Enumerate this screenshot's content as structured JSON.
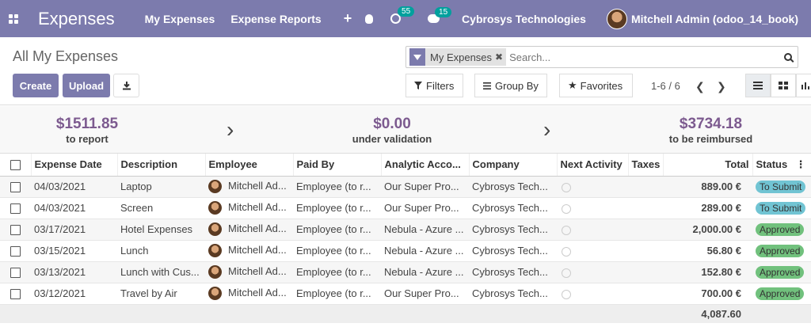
{
  "navbar": {
    "brand": "Expenses",
    "menus": [
      "My Expenses",
      "Expense Reports"
    ],
    "plus": "+",
    "activity_count": "55",
    "message_count": "15",
    "company": "Cybrosys Technologies",
    "user": "Mitchell Admin (odoo_14_book)",
    "color": "#7c7bad"
  },
  "control": {
    "breadcrumb": "All My Expenses",
    "create_label": "Create",
    "upload_label": "Upload",
    "search_facet": "My Expenses",
    "search_placeholder": "Search...",
    "filters_label": "Filters",
    "groupby_label": "Group By",
    "favorites_label": "Favorites",
    "pager": "1-6 / 6"
  },
  "summary": [
    {
      "amount": "$1511.85",
      "label": "to report"
    },
    {
      "amount": "$0.00",
      "label": "under validation"
    },
    {
      "amount": "$3734.18",
      "label": "to be reimbursed"
    }
  ],
  "table": {
    "columns": [
      "Expense Date",
      "Description",
      "Employee",
      "Paid By",
      "Analytic Acco...",
      "Company",
      "Next Activity",
      "Taxes",
      "Total",
      "Status"
    ],
    "rows": [
      {
        "date": "04/03/2021",
        "desc": "Laptop",
        "emp": "Mitchell Ad...",
        "paid": "Employee (to r...",
        "analytic": "Our Super Pro...",
        "company": "Cybrosys Tech...",
        "total": "889.00 €",
        "status": "To Submit"
      },
      {
        "date": "04/03/2021",
        "desc": "Screen",
        "emp": "Mitchell Ad...",
        "paid": "Employee (to r...",
        "analytic": "Our Super Pro...",
        "company": "Cybrosys Tech...",
        "total": "289.00 €",
        "status": "To Submit"
      },
      {
        "date": "03/17/2021",
        "desc": "Hotel Expenses",
        "emp": "Mitchell Ad...",
        "paid": "Employee (to r...",
        "analytic": "Nebula - Azure ...",
        "company": "Cybrosys Tech...",
        "total": "2,000.00 €",
        "status": "Approved"
      },
      {
        "date": "03/15/2021",
        "desc": "Lunch",
        "emp": "Mitchell Ad...",
        "paid": "Employee (to r...",
        "analytic": "Nebula - Azure ...",
        "company": "Cybrosys Tech...",
        "total": "56.80 €",
        "status": "Approved"
      },
      {
        "date": "03/13/2021",
        "desc": "Lunch with Cus...",
        "emp": "Mitchell Ad...",
        "paid": "Employee (to r...",
        "analytic": "Nebula - Azure ...",
        "company": "Cybrosys Tech...",
        "total": "152.80 €",
        "status": "Approved"
      },
      {
        "date": "03/12/2021",
        "desc": "Travel by Air",
        "emp": "Mitchell Ad...",
        "paid": "Employee (to r...",
        "analytic": "Our Super Pro...",
        "company": "Cybrosys Tech...",
        "total": "700.00 €",
        "status": "Approved"
      }
    ],
    "footer_total": "4,087.60",
    "status_colors": {
      "To Submit": "#71c4d3",
      "Approved": "#71c17d"
    }
  }
}
